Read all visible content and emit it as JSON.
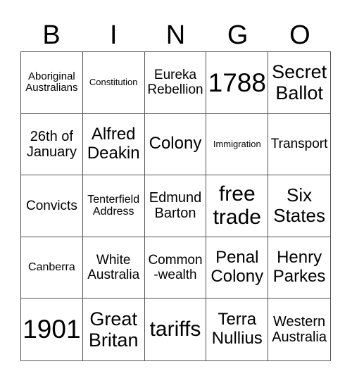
{
  "header": {
    "letters": [
      "B",
      "I",
      "N",
      "G",
      "O"
    ]
  },
  "cells": [
    [
      "Aboriginal\nAustralians",
      "Constitution",
      "Eureka\nRebellion",
      "1788",
      "Secret\nBallot"
    ],
    [
      "26th of\nJanuary",
      "Alfred\nDeakin",
      "Colony",
      "Immigration",
      "Transport"
    ],
    [
      "Convicts",
      "Tenterfield\nAddress",
      "Edmund\nBarton",
      "free\ntrade",
      "Six\nStates"
    ],
    [
      "Canberra",
      "White\nAustralia",
      "Common\n-wealth",
      "Penal\nColony",
      "Henry\nParkes"
    ],
    [
      "1901",
      "Great\nBritan",
      "tariffs",
      "Terra\nNullius",
      "Western\nAustralia"
    ]
  ]
}
